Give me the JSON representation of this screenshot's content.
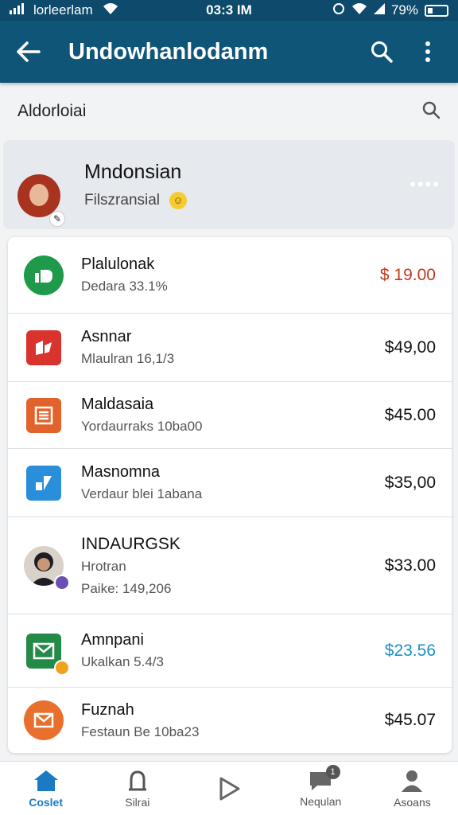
{
  "status_bar": {
    "carrier": "lorleerlam",
    "time": "03:3 IM",
    "battery": "79%"
  },
  "app_bar": {
    "title": "Undowhanlodanm"
  },
  "section": {
    "label": "Aldorloiai"
  },
  "profile": {
    "name": "Mndonsian",
    "subtitle": "Filszransial"
  },
  "transactions": [
    {
      "title": "Plalulonak",
      "sub": "Dedara 33.1%",
      "amount": "$ 19.00",
      "amount_color": "#c0391b",
      "icon": "cash-icon",
      "icon_color": "#1f9a4a"
    },
    {
      "title": "Asnnar",
      "sub": "Mlaulran 16,1/3",
      "amount": "$49,00",
      "amount_color": "#111111",
      "icon": "tag-icon",
      "icon_color": "#d9332e"
    },
    {
      "title": "Maldasaia",
      "sub": "Yordaurraks 10ba00",
      "amount": "$45.00",
      "amount_color": "#111111",
      "icon": "clipboard-icon",
      "icon_color": "#e2622c"
    },
    {
      "title": "Masnomna",
      "sub": "Verdaur blei 1abana",
      "amount": "$35,00",
      "amount_color": "#111111",
      "icon": "shapes-icon",
      "icon_color": "#2a8fdb"
    },
    {
      "title": "INDAURGSK",
      "sub": "Hrotran",
      "sub2": "Paike: 149,206",
      "amount": "$33.00",
      "amount_color": "#111111",
      "icon": "person-avatar",
      "icon_color": "#2a2a2a"
    },
    {
      "title": "Amnpani",
      "sub": "Ukalkan 5.4/3",
      "amount": "$23.56",
      "amount_color": "#1a8fc7",
      "icon": "mail-icon",
      "icon_color": "#238a48"
    },
    {
      "title": "Fuznah",
      "sub": "Festaun Be 10ba23",
      "amount": "$45.07",
      "amount_color": "#111111",
      "icon": "envelope-icon",
      "icon_color": "#e8702c"
    }
  ],
  "bottom_nav": [
    {
      "label": "Coslet",
      "icon": "home-icon",
      "active": true
    },
    {
      "label": "Silrai",
      "icon": "bell-icon",
      "active": false
    },
    {
      "label": "",
      "icon": "play-icon",
      "active": false
    },
    {
      "label": "Nequlan",
      "icon": "chat-icon",
      "active": false,
      "badge": "1"
    },
    {
      "label": "Asoans",
      "icon": "person-icon",
      "active": false
    }
  ]
}
